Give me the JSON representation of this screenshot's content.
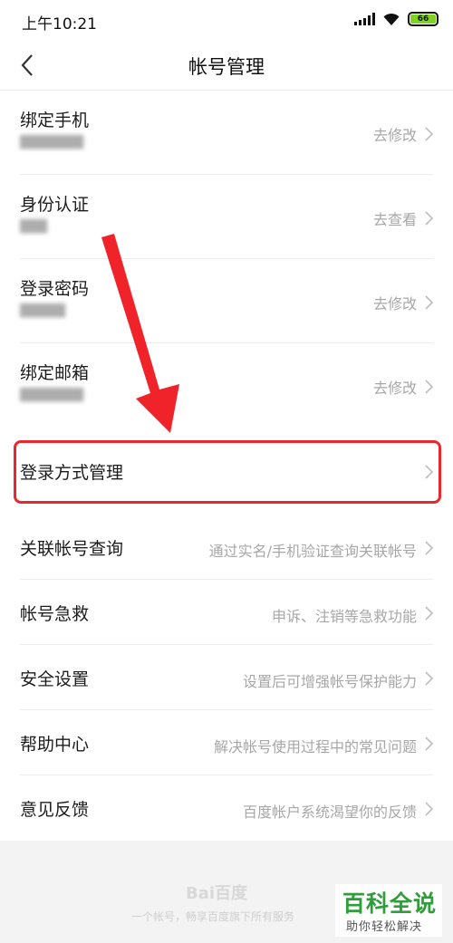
{
  "status_bar": {
    "time": "上午10:21",
    "battery": "66"
  },
  "nav": {
    "title": "帐号管理"
  },
  "account_items": [
    {
      "title": "绑定手机",
      "hint": "去修改"
    },
    {
      "title": "身份认证",
      "hint": "去查看"
    },
    {
      "title": "登录密码",
      "hint": "去修改"
    },
    {
      "title": "绑定邮箱",
      "hint": "去修改"
    }
  ],
  "login_method": {
    "title": "登录方式管理"
  },
  "more_items": [
    {
      "title": "关联帐号查询",
      "hint": "通过实名/手机验证查询关联帐号"
    },
    {
      "title": "帐号急救",
      "hint": "申诉、注销等急救功能"
    },
    {
      "title": "安全设置",
      "hint": "设置后可增强帐号保护能力"
    },
    {
      "title": "帮助中心",
      "hint": "解决帐号使用过程中的常见问题"
    },
    {
      "title": "意见反馈",
      "hint": "百度帐户系统渴望你的反馈"
    }
  ],
  "footer": {
    "logo": "Bai百度",
    "tagline": "一个帐号，畅享百度旗下所有服务"
  },
  "watermark": {
    "title": "百科全说",
    "subtitle": "助你轻松解决"
  },
  "colors": {
    "highlight": "#e8282f",
    "arrow": "#f0232b",
    "battery": "#7ed321",
    "watermark_green": "#2e9d3a"
  }
}
